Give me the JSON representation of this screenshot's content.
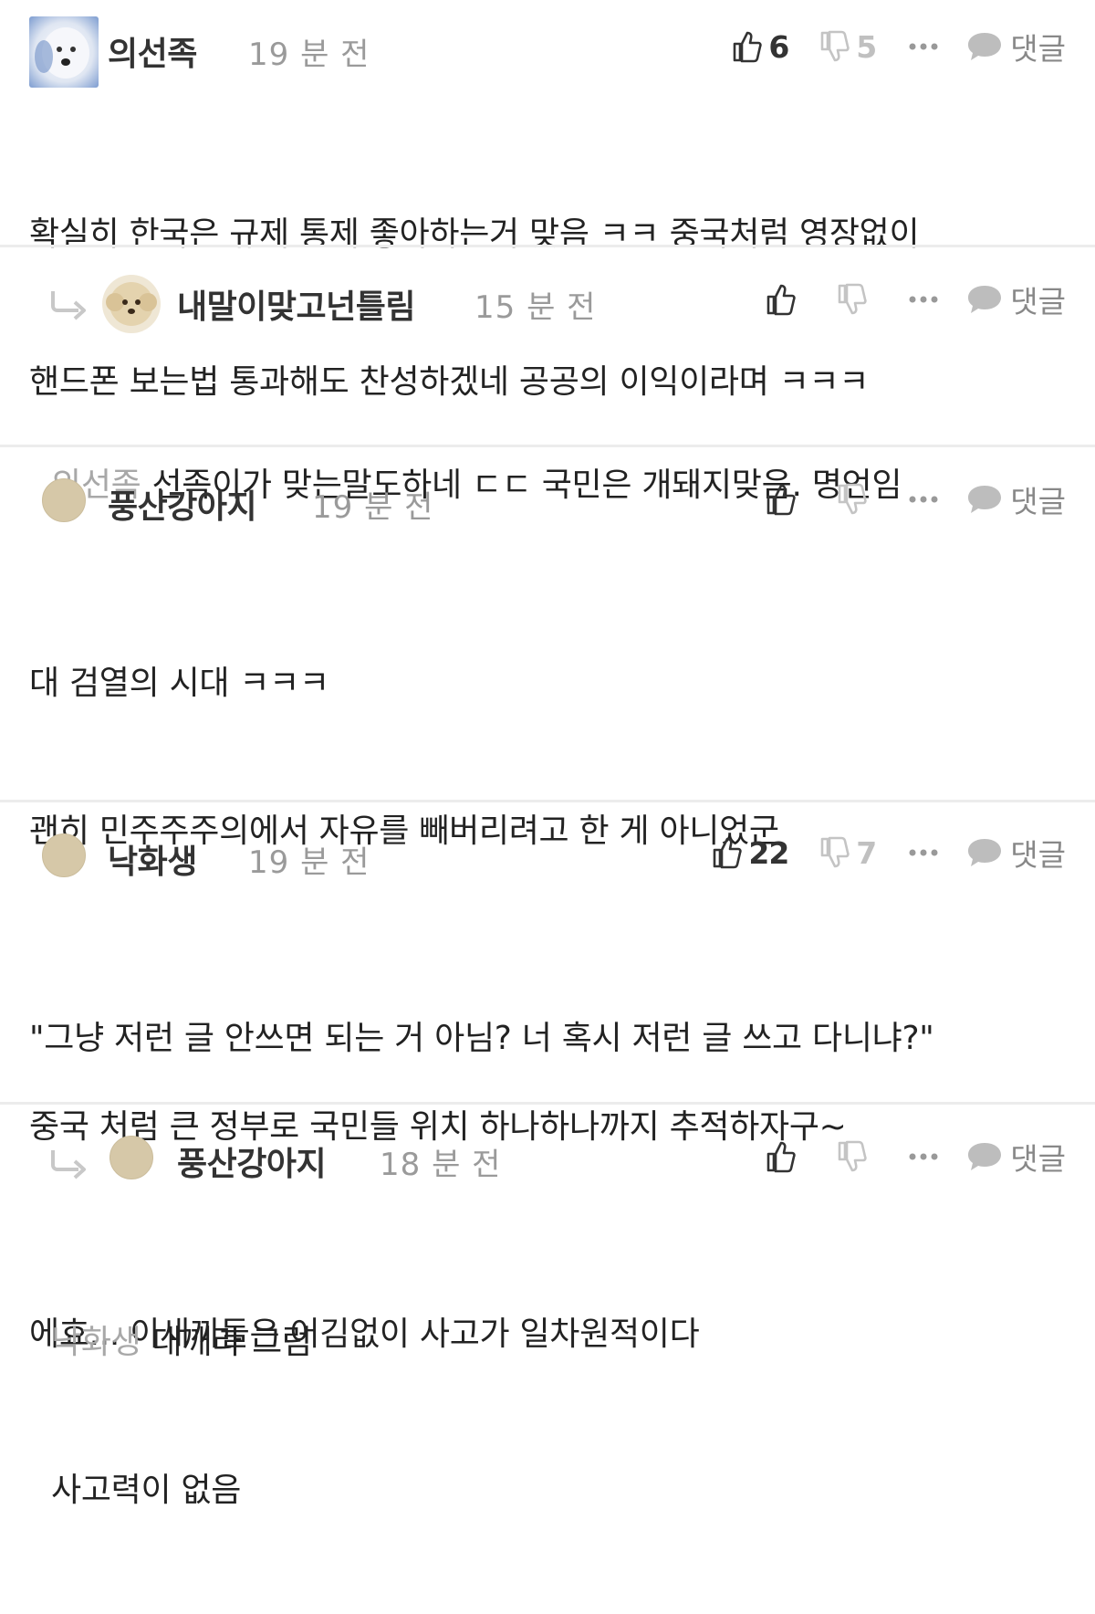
{
  "comments": [
    {
      "author": "의선족",
      "time": "19 분 전",
      "likes": "6",
      "dislikes": "5",
      "more_icon": "more-dots-icon",
      "reply_label": "댓글",
      "avatar": "white-dog-photo",
      "lines": [
        "확실히 한국은 규제 통제 좋아하는거 맞음 ㅋㅋ 중국처럼 영장없이",
        "핸드폰 보는법 통과해도 찬성하겠네 공공의 이익이라며 ㅋㅋㅋ"
      ]
    },
    {
      "is_reply": true,
      "author": "내말이맞고넌틀림",
      "time": "15 분 전",
      "reply_label": "댓글",
      "avatar": "puppy-photo",
      "mention": "의선족",
      "lines": [
        "선족이가 맞는말도하네 ㄷㄷ 국민은 개돼지맞음. 명언임"
      ]
    },
    {
      "author": "풍산강아지",
      "time": "19 분 전",
      "reply_label": "댓글",
      "avatar": "default-tan",
      "lines": [
        "대 검열의 시대 ㅋㅋㅋ",
        "괜히 민주주주의에서 자유를 빼버리려고 한 게 아니었군",
        "",
        "중국 처럼 큰 정부로 국민들 위치 하나하나까지 추적하자구~"
      ]
    },
    {
      "author": "낙화생",
      "time": "19 분 전",
      "likes": "22",
      "dislikes": "7",
      "reply_label": "댓글",
      "avatar": "default-tan",
      "lines": [
        "\"그냥 저런 글 안쓰면 되는 거 아님? 너 혹시 저런 글 쓰고 다니냐?\"",
        "",
        "에효... 이새끼들은 어김없이 사고가 일차원적이다"
      ]
    },
    {
      "is_reply": true,
      "author": "풍산강아지",
      "time": "18 분 전",
      "reply_label": "댓글",
      "avatar": "default-tan",
      "mention": "낙화생",
      "lines": [
        "대깨라 그럼",
        "사고력이 없음"
      ]
    }
  ],
  "colors": {
    "text": "#222222",
    "muted": "#9a9a9a",
    "mention": "#a8a8a8",
    "avatar_default": "#d6c8a8",
    "divider": "#ececec"
  }
}
